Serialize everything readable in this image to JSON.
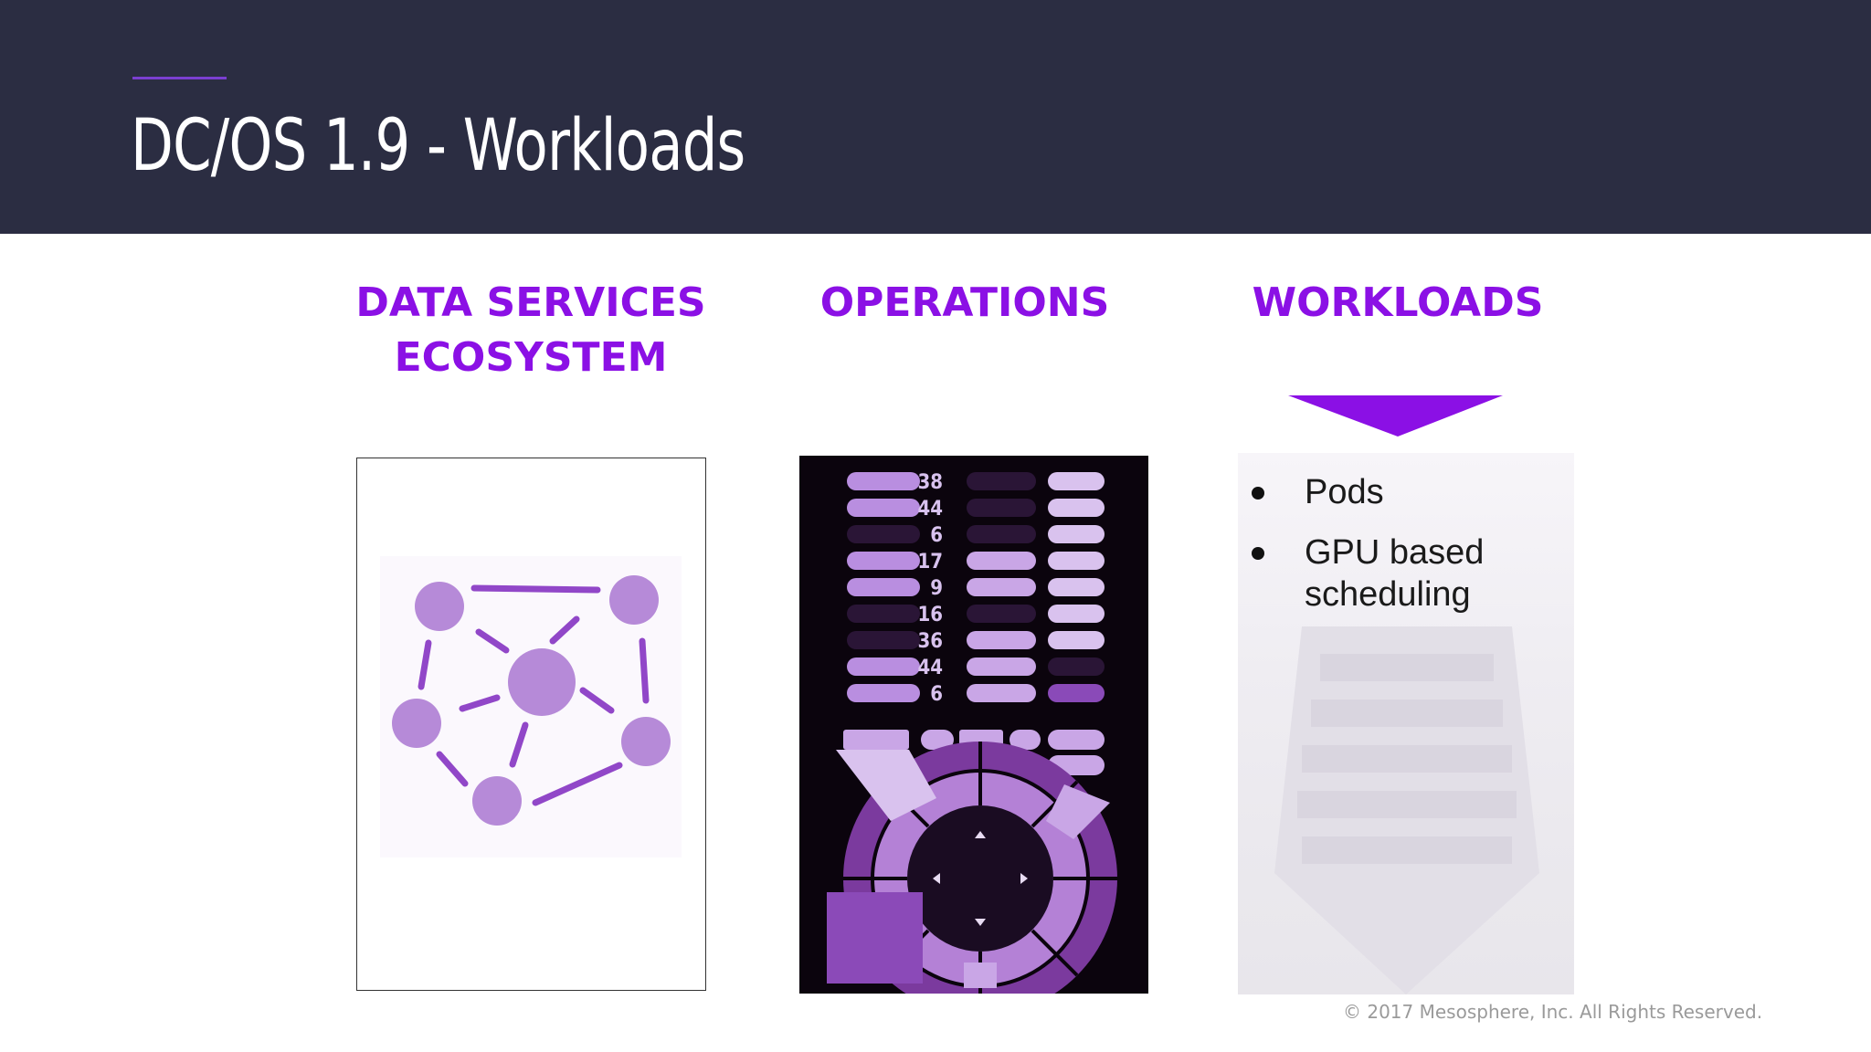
{
  "slide": {
    "title": "DC/OS 1.9 - Workloads",
    "accent_color": "#7b3fd1",
    "header_bg": "#2b2d42",
    "heading_color": "#8b10e5"
  },
  "columns": [
    {
      "title_lines": [
        "DATA SERVICES",
        "ECOSYSTEM"
      ],
      "image": "network-graph-icon"
    },
    {
      "title_lines": [
        "OPERATIONS"
      ],
      "image": "control-panel-icon"
    },
    {
      "title_lines": [
        "WORKLOADS"
      ],
      "image": "container-ship-icon",
      "bullets": [
        "Pods",
        "GPU based scheduling"
      ]
    }
  ],
  "ops_panel": {
    "numbers": [
      "38",
      "44",
      "6",
      "17",
      "9",
      "16",
      "36",
      "44",
      "6"
    ]
  },
  "footer": {
    "copyright": "© 2017 Mesosphere, Inc. All Rights Reserved."
  }
}
